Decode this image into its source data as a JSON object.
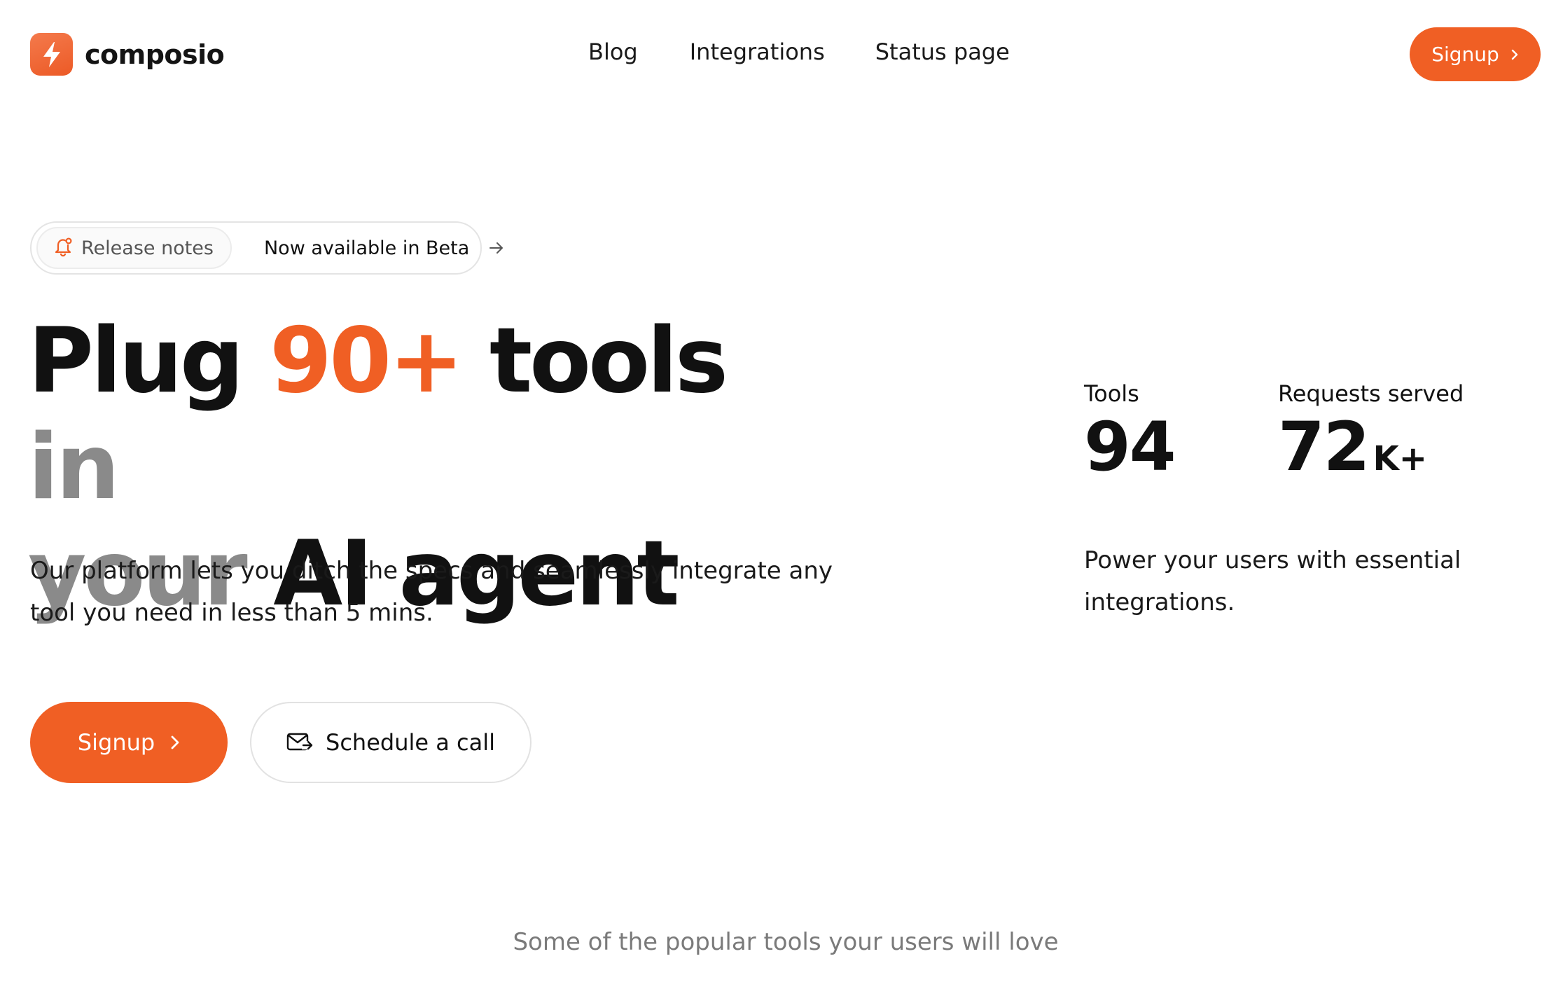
{
  "brand": {
    "name": "composio",
    "icon": "lightning-bolt-icon",
    "accent": "#f05f24"
  },
  "nav": {
    "items": [
      "Blog",
      "Integrations",
      "Status page"
    ]
  },
  "header": {
    "signup_label": "Signup"
  },
  "release": {
    "tag_label": "Release notes",
    "tag_icon": "bell-icon",
    "message": "Now available in Beta"
  },
  "hero": {
    "headline": {
      "part1": "Plug ",
      "highlight": "90+",
      "part2": " tools ",
      "part3": "in",
      "part4": "your ",
      "part5": "AI agent"
    },
    "subtext": "Our platform lets you ditch the specs and seamlessly integrate any tool you need in less than 5 mins.",
    "signup_label": "Signup",
    "schedule_label": "Schedule a call"
  },
  "stats": {
    "tools": {
      "label": "Tools",
      "value": "94"
    },
    "requests": {
      "label": "Requests served",
      "value": "72",
      "suffix": "K+"
    },
    "description": "Power your users with essential integrations."
  },
  "popular": {
    "caption": "Some of the popular tools your users will love"
  }
}
